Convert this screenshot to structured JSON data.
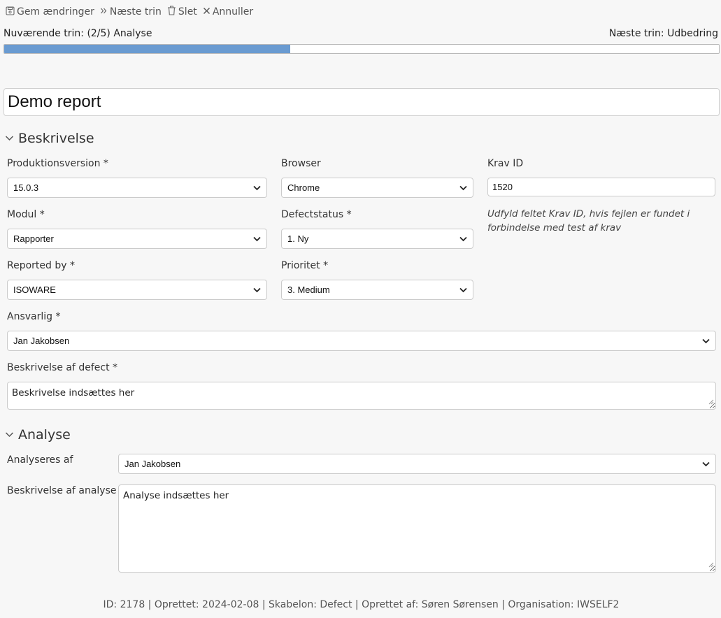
{
  "toolbar": {
    "save_label": "Gem ændringer",
    "next_label": "Næste trin",
    "delete_label": "Slet",
    "cancel_label": "Annuller"
  },
  "progress": {
    "current_text": "Nuværende trin: (2/5) Analyse",
    "next_text": "Næste trin: Udbedring",
    "fraction": 0.4,
    "fill_color": "#6a9bd1"
  },
  "report_title": "Demo report",
  "sections": {
    "description": {
      "heading": "Beskrivelse",
      "production_version": {
        "label": "Produktionsversion *",
        "value": "15.0.3"
      },
      "browser": {
        "label": "Browser",
        "value": "Chrome"
      },
      "requirement_id": {
        "label": "Krav ID",
        "value": "1520",
        "hint": "Udfyld feltet Krav ID, hvis fejlen er fundet i forbindelse med test af krav"
      },
      "module": {
        "label": "Modul *",
        "value": "Rapporter"
      },
      "defect_status": {
        "label": "Defectstatus *",
        "value": "1. Ny"
      },
      "reported_by": {
        "label": "Reported by *",
        "value": "ISOWARE"
      },
      "priority": {
        "label": "Prioritet *",
        "value": "3. Medium"
      },
      "responsible": {
        "label": "Ansvarlig *",
        "value": "Jan Jakobsen"
      },
      "defect_description": {
        "label": "Beskrivelse af defect *",
        "value": "Beskrivelse indsættes her"
      }
    },
    "analysis": {
      "heading": "Analyse",
      "analysed_by": {
        "label": "Analyseres af",
        "value": "Jan Jakobsen"
      },
      "analysis_description": {
        "label": "Beskrivelse af analyse",
        "value": "Analyse indsættes her"
      }
    }
  },
  "footer": "ID: 2178 | Oprettet: 2024-02-08 | Skabelon: Defect | Oprettet af: Søren Sørensen | Organisation: IWSELF2",
  "icons": {
    "save": "floppy-disk-icon",
    "next": "double-chevron-right-icon",
    "delete": "trash-icon",
    "cancel": "close-icon",
    "section_toggle": "chevron-down-icon"
  }
}
